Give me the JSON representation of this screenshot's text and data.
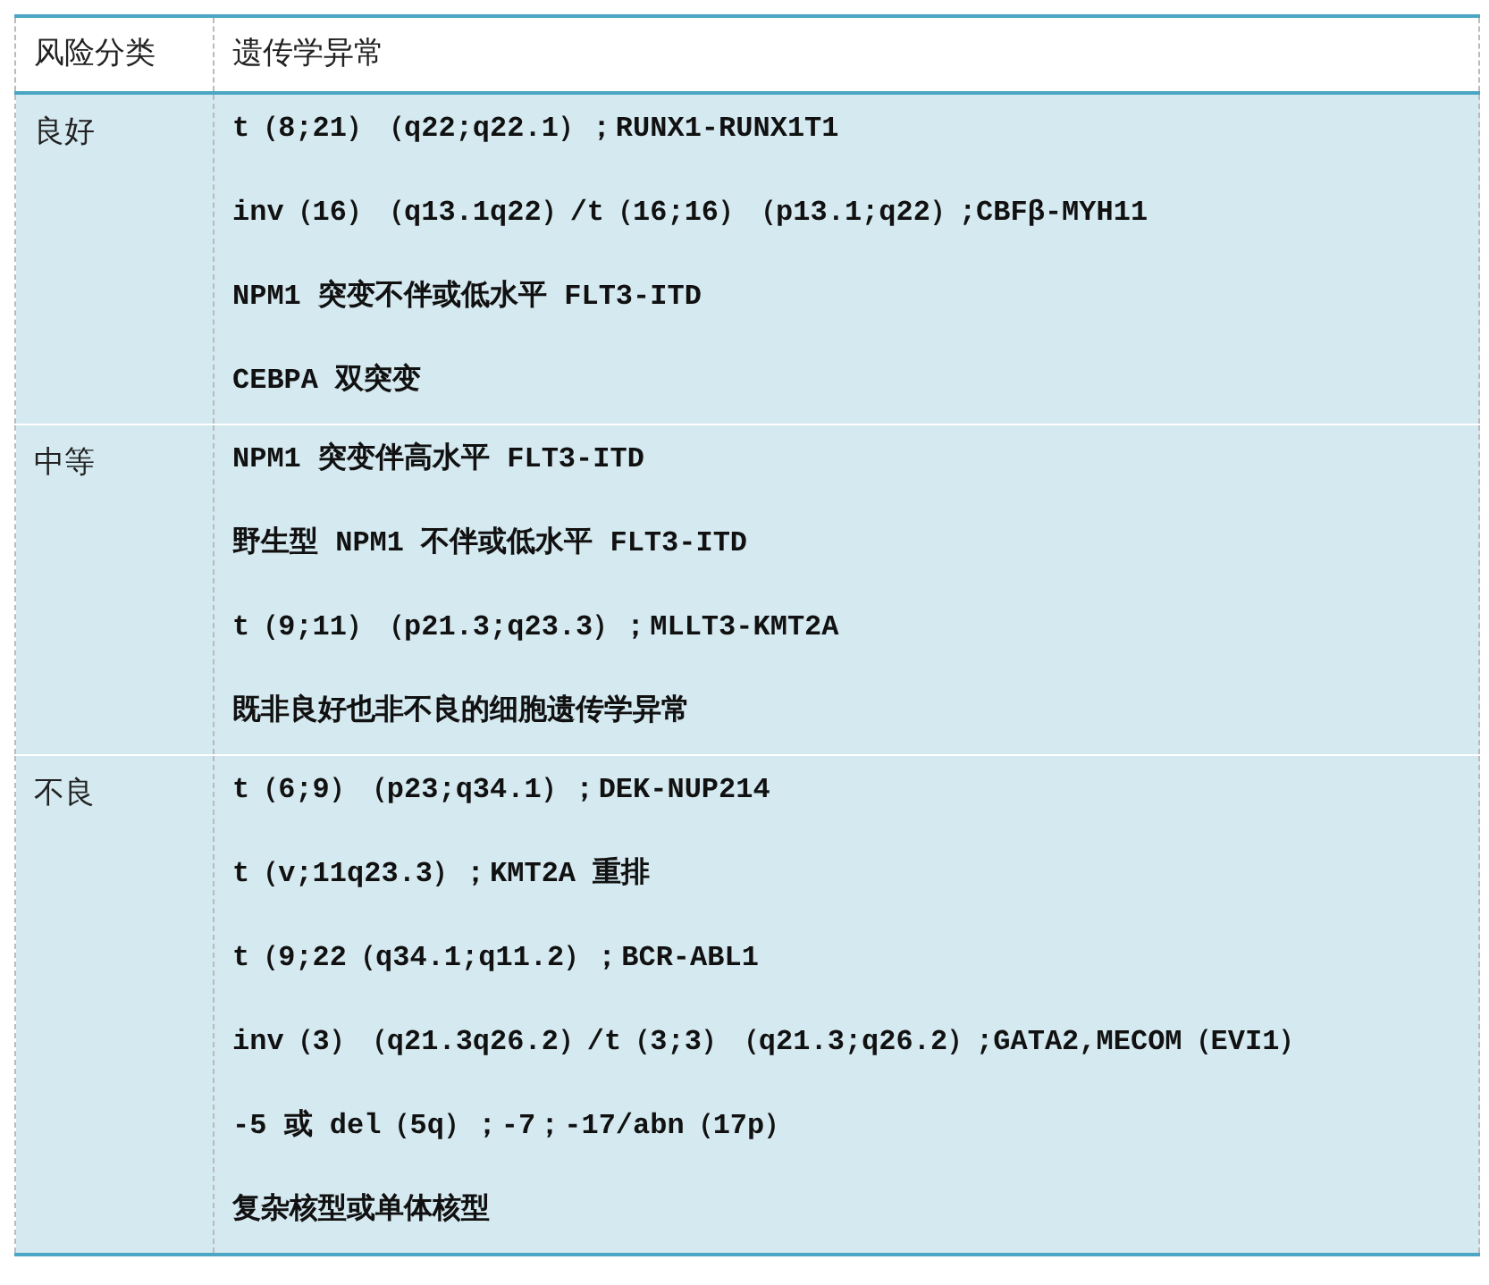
{
  "table": {
    "columns": [
      "风险分类",
      "遗传学异常"
    ],
    "rows": [
      {
        "category": "良好",
        "abnormalities": [
          "t（8;21）（q22;q22.1）；RUNX1-RUNX1T1",
          "inv（16）（q13.1q22）/t（16;16）（p13.1;q22）;CBFβ-MYH11",
          "NPM1 突变不伴或低水平 FLT3-ITD",
          "CEBPA 双突变"
        ]
      },
      {
        "category": "中等",
        "abnormalities": [
          "NPM1 突变伴高水平 FLT3-ITD",
          "野生型 NPM1 不伴或低水平 FLT3-ITD",
          "t（9;11）（p21.3;q23.3）；MLLT3-KMT2A",
          "既非良好也非不良的细胞遗传学异常"
        ]
      },
      {
        "category": "不良",
        "abnormalities": [
          "t（6;9）（p23;q34.1）；DEK-NUP214",
          "t（v;11q23.3）；KMT2A 重排",
          "t（9;22（q34.1;q11.2）；BCR-ABL1",
          "inv（3）（q21.3q26.2）/t（3;3）（q21.3;q26.2）;GATA2,MECOM（EVI1）",
          "-5 或 del（5q）；-7；-17/abn（17p）",
          "复杂核型或单体核型"
        ]
      }
    ]
  }
}
